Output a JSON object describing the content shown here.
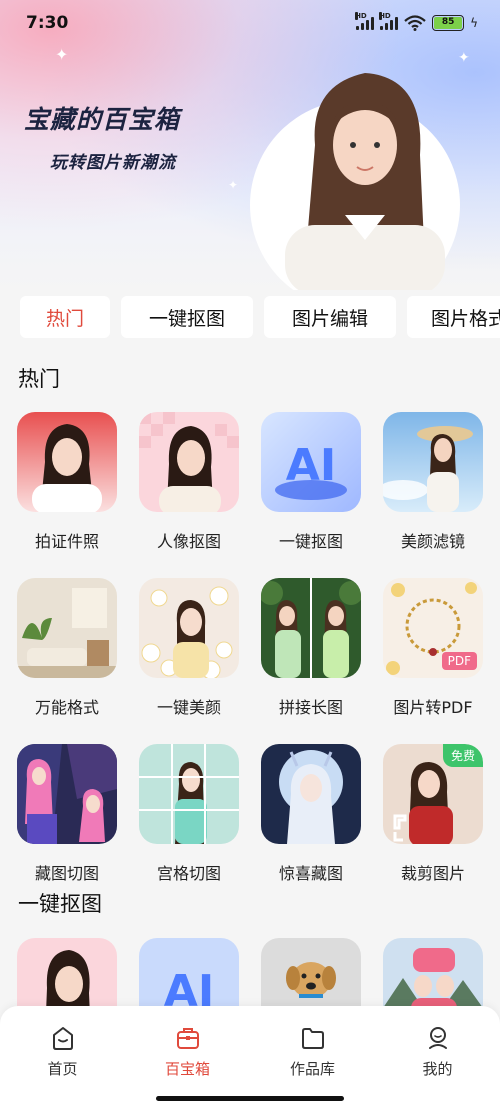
{
  "status": {
    "time": "7:30",
    "battery": "85",
    "hd1": "HD",
    "hd2": "HD"
  },
  "hero": {
    "title": "宝藏的百宝箱",
    "subtitle": "玩转图片新潮流"
  },
  "tabs": [
    "热门",
    "一键抠图",
    "图片编辑",
    "图片格式"
  ],
  "sections": {
    "hot": {
      "title": "热门",
      "items": [
        {
          "label": "拍证件照"
        },
        {
          "label": "人像抠图"
        },
        {
          "label": "一键抠图"
        },
        {
          "label": "美颜滤镜"
        },
        {
          "label": "万能格式"
        },
        {
          "label": "一键美颜"
        },
        {
          "label": "拼接长图"
        },
        {
          "label": "图片转PDF",
          "badge": "PDF"
        },
        {
          "label": "藏图切图"
        },
        {
          "label": "宫格切图"
        },
        {
          "label": "惊喜藏图"
        },
        {
          "label": "裁剪图片",
          "badge": "免费"
        }
      ]
    },
    "cutout": {
      "title": "一键抠图"
    }
  },
  "nav": {
    "items": [
      {
        "label": "首页",
        "icon": "home-icon"
      },
      {
        "label": "百宝箱",
        "icon": "toolbox-icon"
      },
      {
        "label": "作品库",
        "icon": "folder-icon"
      },
      {
        "label": "我的",
        "icon": "profile-icon"
      }
    ]
  },
  "colors": {
    "accent": "#e04a3c",
    "free_badge": "#3dc46a",
    "pdf_badge": "#f06a8a"
  }
}
